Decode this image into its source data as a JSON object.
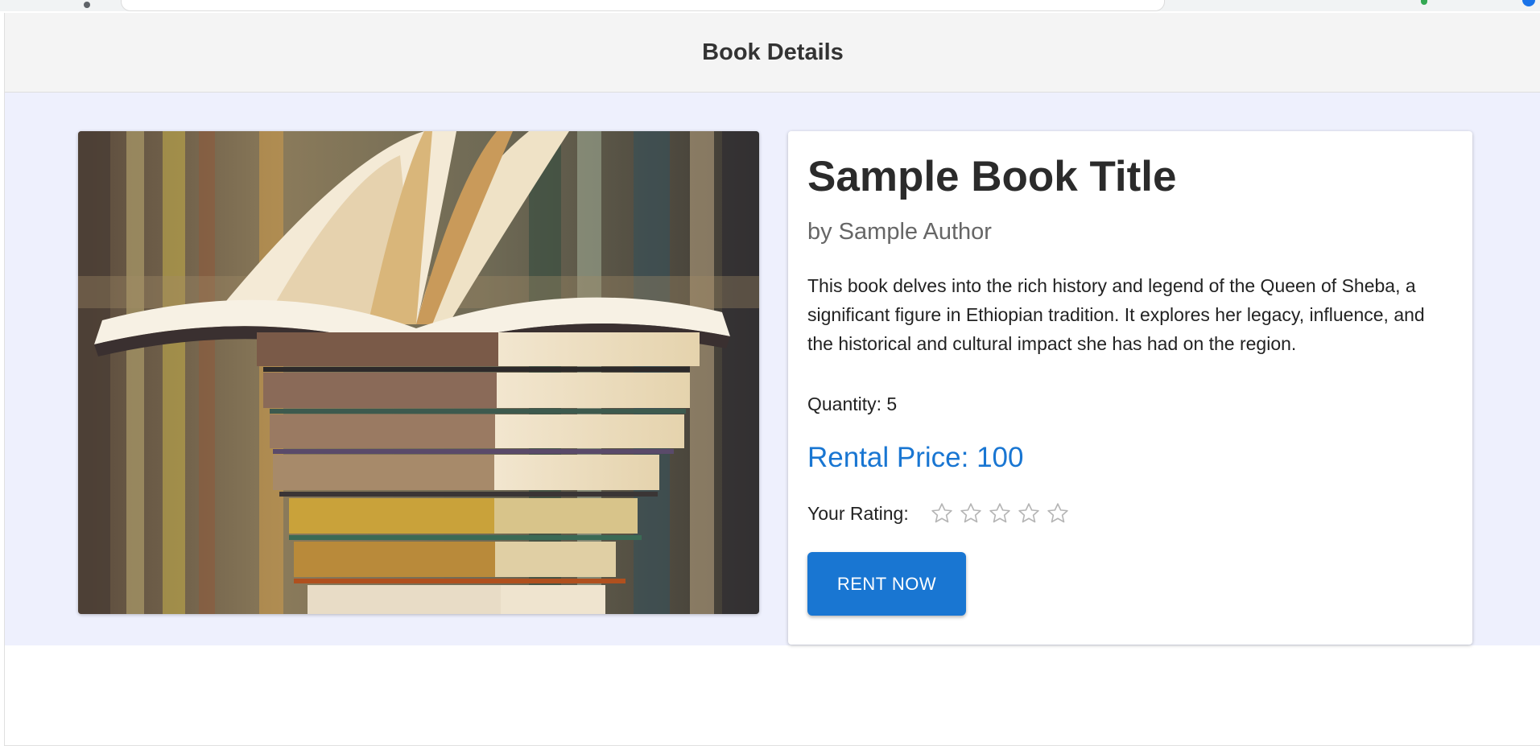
{
  "header": {
    "title": "Book Details"
  },
  "book": {
    "title": "Sample Book Title",
    "author": "by Sample Author",
    "description": "This book delves into the rich history and legend of the Queen of Sheba, a significant figure in Ethiopian tradition. It explores her legacy, influence, and the historical and cultural impact she has had on the region.",
    "quantity": "Quantity: 5",
    "rental_price": "Rental Price: 100",
    "cover_image": "stack-of-books-photo"
  },
  "rating": {
    "label": "Your Rating:",
    "value": 0,
    "max": 5,
    "icon": "star-outline-icon"
  },
  "actions": {
    "rent_label": "RENT NOW"
  },
  "colors": {
    "accent": "#1976d2",
    "header_bg": "#f4f4f4",
    "content_bg": "#eef0fd"
  }
}
